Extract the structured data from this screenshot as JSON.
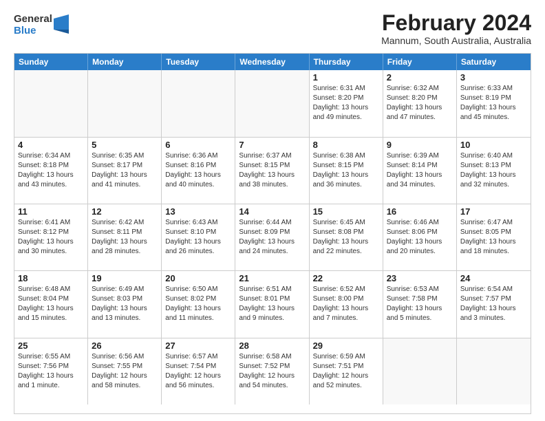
{
  "logo": {
    "general": "General",
    "blue": "Blue"
  },
  "header": {
    "month": "February 2024",
    "location": "Mannum, South Australia, Australia"
  },
  "weekdays": [
    "Sunday",
    "Monday",
    "Tuesday",
    "Wednesday",
    "Thursday",
    "Friday",
    "Saturday"
  ],
  "weeks": [
    [
      {
        "day": "",
        "info": ""
      },
      {
        "day": "",
        "info": ""
      },
      {
        "day": "",
        "info": ""
      },
      {
        "day": "",
        "info": ""
      },
      {
        "day": "1",
        "info": "Sunrise: 6:31 AM\nSunset: 8:20 PM\nDaylight: 13 hours\nand 49 minutes."
      },
      {
        "day": "2",
        "info": "Sunrise: 6:32 AM\nSunset: 8:20 PM\nDaylight: 13 hours\nand 47 minutes."
      },
      {
        "day": "3",
        "info": "Sunrise: 6:33 AM\nSunset: 8:19 PM\nDaylight: 13 hours\nand 45 minutes."
      }
    ],
    [
      {
        "day": "4",
        "info": "Sunrise: 6:34 AM\nSunset: 8:18 PM\nDaylight: 13 hours\nand 43 minutes."
      },
      {
        "day": "5",
        "info": "Sunrise: 6:35 AM\nSunset: 8:17 PM\nDaylight: 13 hours\nand 41 minutes."
      },
      {
        "day": "6",
        "info": "Sunrise: 6:36 AM\nSunset: 8:16 PM\nDaylight: 13 hours\nand 40 minutes."
      },
      {
        "day": "7",
        "info": "Sunrise: 6:37 AM\nSunset: 8:15 PM\nDaylight: 13 hours\nand 38 minutes."
      },
      {
        "day": "8",
        "info": "Sunrise: 6:38 AM\nSunset: 8:15 PM\nDaylight: 13 hours\nand 36 minutes."
      },
      {
        "day": "9",
        "info": "Sunrise: 6:39 AM\nSunset: 8:14 PM\nDaylight: 13 hours\nand 34 minutes."
      },
      {
        "day": "10",
        "info": "Sunrise: 6:40 AM\nSunset: 8:13 PM\nDaylight: 13 hours\nand 32 minutes."
      }
    ],
    [
      {
        "day": "11",
        "info": "Sunrise: 6:41 AM\nSunset: 8:12 PM\nDaylight: 13 hours\nand 30 minutes."
      },
      {
        "day": "12",
        "info": "Sunrise: 6:42 AM\nSunset: 8:11 PM\nDaylight: 13 hours\nand 28 minutes."
      },
      {
        "day": "13",
        "info": "Sunrise: 6:43 AM\nSunset: 8:10 PM\nDaylight: 13 hours\nand 26 minutes."
      },
      {
        "day": "14",
        "info": "Sunrise: 6:44 AM\nSunset: 8:09 PM\nDaylight: 13 hours\nand 24 minutes."
      },
      {
        "day": "15",
        "info": "Sunrise: 6:45 AM\nSunset: 8:08 PM\nDaylight: 13 hours\nand 22 minutes."
      },
      {
        "day": "16",
        "info": "Sunrise: 6:46 AM\nSunset: 8:06 PM\nDaylight: 13 hours\nand 20 minutes."
      },
      {
        "day": "17",
        "info": "Sunrise: 6:47 AM\nSunset: 8:05 PM\nDaylight: 13 hours\nand 18 minutes."
      }
    ],
    [
      {
        "day": "18",
        "info": "Sunrise: 6:48 AM\nSunset: 8:04 PM\nDaylight: 13 hours\nand 15 minutes."
      },
      {
        "day": "19",
        "info": "Sunrise: 6:49 AM\nSunset: 8:03 PM\nDaylight: 13 hours\nand 13 minutes."
      },
      {
        "day": "20",
        "info": "Sunrise: 6:50 AM\nSunset: 8:02 PM\nDaylight: 13 hours\nand 11 minutes."
      },
      {
        "day": "21",
        "info": "Sunrise: 6:51 AM\nSunset: 8:01 PM\nDaylight: 13 hours\nand 9 minutes."
      },
      {
        "day": "22",
        "info": "Sunrise: 6:52 AM\nSunset: 8:00 PM\nDaylight: 13 hours\nand 7 minutes."
      },
      {
        "day": "23",
        "info": "Sunrise: 6:53 AM\nSunset: 7:58 PM\nDaylight: 13 hours\nand 5 minutes."
      },
      {
        "day": "24",
        "info": "Sunrise: 6:54 AM\nSunset: 7:57 PM\nDaylight: 13 hours\nand 3 minutes."
      }
    ],
    [
      {
        "day": "25",
        "info": "Sunrise: 6:55 AM\nSunset: 7:56 PM\nDaylight: 13 hours\nand 1 minute."
      },
      {
        "day": "26",
        "info": "Sunrise: 6:56 AM\nSunset: 7:55 PM\nDaylight: 12 hours\nand 58 minutes."
      },
      {
        "day": "27",
        "info": "Sunrise: 6:57 AM\nSunset: 7:54 PM\nDaylight: 12 hours\nand 56 minutes."
      },
      {
        "day": "28",
        "info": "Sunrise: 6:58 AM\nSunset: 7:52 PM\nDaylight: 12 hours\nand 54 minutes."
      },
      {
        "day": "29",
        "info": "Sunrise: 6:59 AM\nSunset: 7:51 PM\nDaylight: 12 hours\nand 52 minutes."
      },
      {
        "day": "",
        "info": ""
      },
      {
        "day": "",
        "info": ""
      }
    ]
  ]
}
